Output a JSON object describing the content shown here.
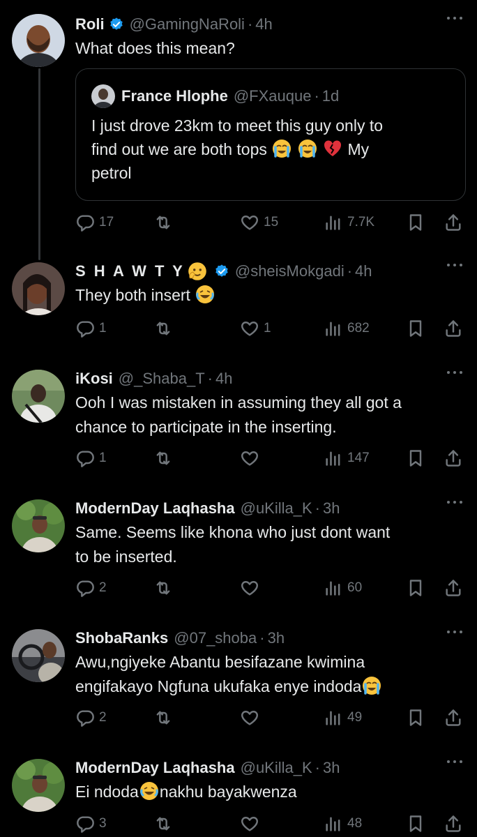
{
  "tweets": [
    {
      "name": "Roli",
      "handle": "@GamingNaRoli",
      "dot": "·",
      "time": "4h",
      "verified": true,
      "text": "What does this mean?",
      "quote": {
        "name": "France Hlophe",
        "handle": "@FXauque",
        "dot": "·",
        "time": "1d",
        "line1": "I just drove 23km to meet this guy only to",
        "line2a": "find out we are both tops ",
        "line2b": " My",
        "line3": "petrol"
      },
      "stats": {
        "replies": "17",
        "reposts": "",
        "likes": "15",
        "views": "7.7K"
      }
    },
    {
      "name": "S H A W T Y",
      "handle": "@sheisMokgadi",
      "dot": "·",
      "time": "4h",
      "verified": true,
      "text": "They both insert",
      "stats": {
        "replies": "1",
        "reposts": "",
        "likes": "1",
        "views": "682"
      }
    },
    {
      "name": "iKosi",
      "handle": "@_Shaba_T",
      "dot": "·",
      "time": "4h",
      "verified": false,
      "text1": "Ooh I was mistaken in assuming they all got a",
      "text2": "chance to participate in the inserting.",
      "stats": {
        "replies": "1",
        "reposts": "",
        "likes": "",
        "views": "147"
      }
    },
    {
      "name": "ModernDay Laqhasha",
      "handle": "@uKilla_K",
      "dot": "·",
      "time": "3h",
      "verified": false,
      "text1": "Same. Seems like khona who just dont want",
      "text2": "to be inserted.",
      "stats": {
        "replies": "2",
        "reposts": "",
        "likes": "",
        "views": "60"
      }
    },
    {
      "name": "ShobaRanks",
      "handle": "@07_shoba",
      "dot": "·",
      "time": "3h",
      "verified": false,
      "text1": "Awu,ngiyeke Abantu besifazane kwimina",
      "text2": "engifakayo Ngfuna ukufaka enye indoda",
      "stats": {
        "replies": "2",
        "reposts": "",
        "likes": "",
        "views": "49"
      }
    },
    {
      "name": "ModernDay Laqhasha",
      "handle": "@uKilla_K",
      "dot": "·",
      "time": "3h",
      "verified": false,
      "texta": "Ei ndoda",
      "textb": "nakhu bayakwenza",
      "stats": {
        "replies": "3",
        "reposts": "",
        "likes": "",
        "views": "48"
      }
    }
  ],
  "colors": {
    "background": "#000000",
    "text": "#e7e9ea",
    "muted": "#71767b",
    "verified": "#1d9bf0",
    "border": "#2f3336",
    "thread_line": "#333639"
  },
  "icons": [
    "reply-icon",
    "repost-icon",
    "like-icon",
    "views-icon",
    "bookmark-icon",
    "share-icon",
    "more-icon",
    "verified-badge-icon"
  ]
}
